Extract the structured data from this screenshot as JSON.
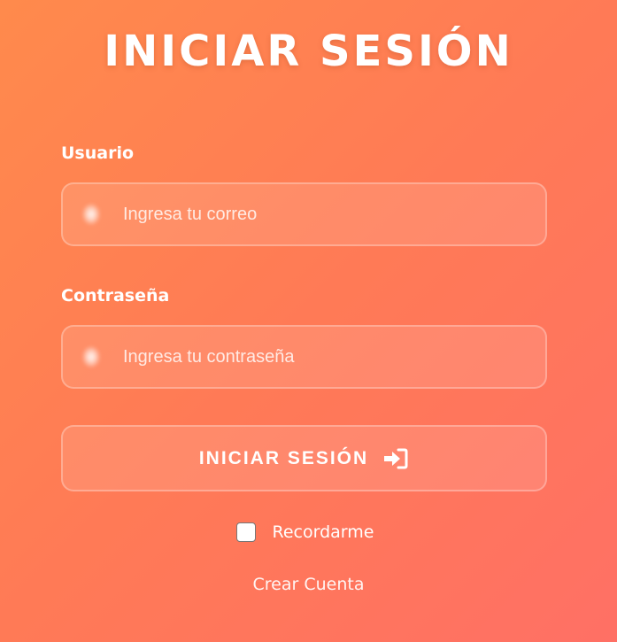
{
  "page": {
    "title": "INICIAR SESIÓN"
  },
  "form": {
    "username": {
      "label": "Usuario",
      "placeholder": "Ingresa tu correo",
      "value": "",
      "icon": "user-icon"
    },
    "password": {
      "label": "Contraseña",
      "placeholder": "Ingresa tu contraseña",
      "value": "",
      "icon": "lock-icon"
    },
    "submit": {
      "label": "INICIAR SESIÓN",
      "icon": "sign-in-icon"
    },
    "remember": {
      "label": "Recordarme",
      "checked": false
    },
    "create_account": {
      "label": "Crear Cuenta"
    }
  },
  "colors": {
    "background_start": "#ff8a4c",
    "background_end": "#ff7065",
    "text": "#ffffff"
  }
}
